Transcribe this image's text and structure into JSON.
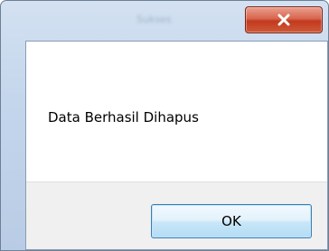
{
  "dialog": {
    "title": "Sukses",
    "message": "Data Berhasil Dihapus",
    "ok_label": "OK"
  },
  "icons": {
    "close": "close-icon"
  },
  "colors": {
    "close_button": "#c2391e",
    "frame": "#c4d6ec",
    "button_bar": "#f0f0f0",
    "ok_border": "#3c7fb1"
  }
}
